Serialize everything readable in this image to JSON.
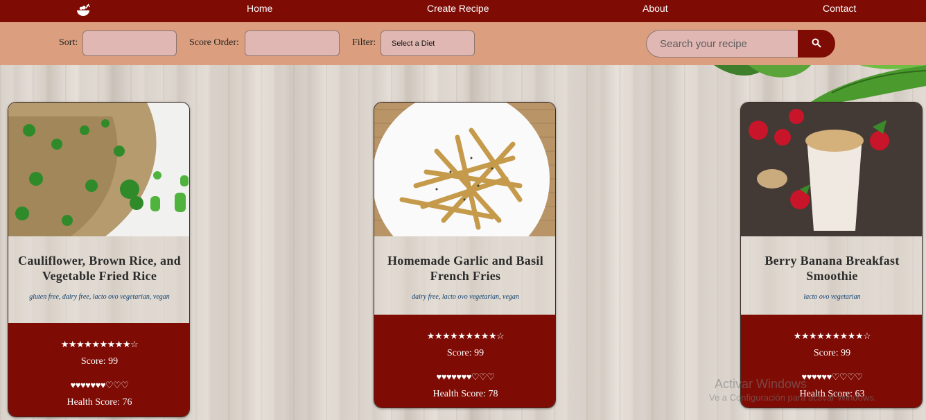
{
  "nav": {
    "logo_icon": "salad-bowl-icon",
    "links": [
      "Home",
      "Create Recipe",
      "About",
      "Contact"
    ]
  },
  "filters": {
    "sort_label": "Sort:",
    "sort_value": "",
    "score_order_label": "Score Order:",
    "score_order_value": "",
    "filter_label": "Filter:",
    "filter_value": "Select a Diet",
    "search_placeholder": "Search your recipe",
    "search_icon": "search-icon"
  },
  "recipes": [
    {
      "title": "Cauliflower, Brown Rice, and Vegetable Fried Rice",
      "diets": "gluten free, dairy free, lacto ovo vegetarian, vegan",
      "stars": "★★★★★★★★★☆",
      "score_label": "Score: 99",
      "score": 99,
      "hearts": "♥♥♥♥♥♥♥♡♡♡",
      "health_label": "Health Score: 76",
      "health_score": 76
    },
    {
      "title": "Homemade Garlic and Basil French Fries",
      "diets": "dairy free, lacto ovo vegetarian, vegan",
      "stars": "★★★★★★★★★☆",
      "score_label": "Score: 99",
      "score": 99,
      "hearts": "♥♥♥♥♥♥♥♡♡♡",
      "health_label": "Health Score: 78",
      "health_score": 78
    },
    {
      "title": "Berry Banana Breakfast Smoothie",
      "diets": "lacto ovo vegetarian",
      "stars": "★★★★★★★★★☆",
      "score_label": "Score: 99",
      "score": 99,
      "hearts": "♥♥♥♥♥♥♡♡♡♡",
      "health_label": "Health Score: 63",
      "health_score": 63
    }
  ],
  "watermark": {
    "title": "Activar Windows",
    "subtitle": "Ve a Configuración para activar Windows."
  },
  "colors": {
    "brand": "#7e0b04",
    "filter_bar": "#db9f7f",
    "input_bg": "#e0b7b3"
  }
}
